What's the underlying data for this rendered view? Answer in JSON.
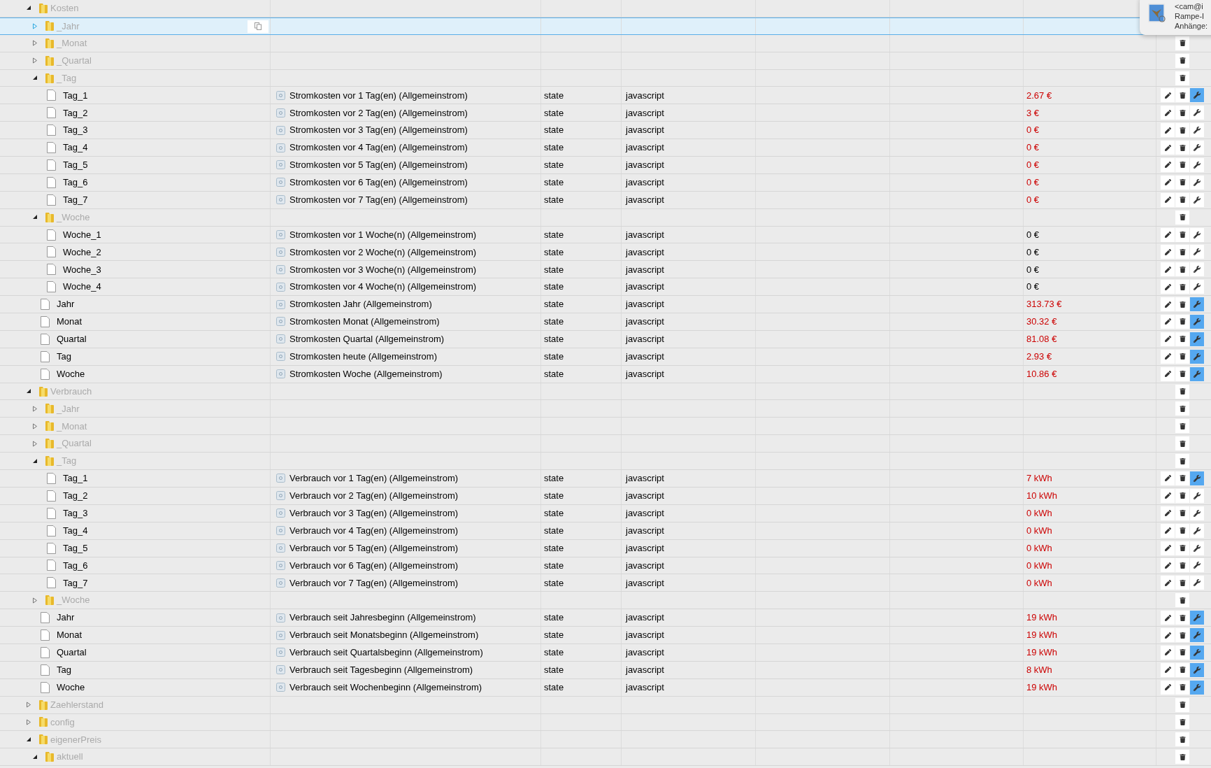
{
  "tree": [
    {
      "kind": "folder",
      "name": "Kosten",
      "expanded": true,
      "selected": false,
      "children": [
        {
          "kind": "folder",
          "name": "_Jahr",
          "expanded": false,
          "selected": true
        },
        {
          "kind": "folder",
          "name": "_Monat",
          "expanded": false,
          "selected": false
        },
        {
          "kind": "folder",
          "name": "_Quartal",
          "expanded": false,
          "selected": false
        },
        {
          "kind": "folder",
          "name": "_Tag",
          "expanded": true,
          "selected": false,
          "children": [
            {
              "kind": "state",
              "name": "Tag_1",
              "description": "Stromkosten vor 1 Tag(en) (Allgemeinstrom)",
              "type": "state",
              "role": "javascript",
              "value": "2.67 €",
              "color": "#cc0000",
              "wrench_active": true,
              "selected": false
            },
            {
              "kind": "state",
              "name": "Tag_2",
              "description": "Stromkosten vor 2 Tag(en) (Allgemeinstrom)",
              "type": "state",
              "role": "javascript",
              "value": "3 €",
              "color": "#cc0000",
              "wrench_active": false,
              "selected": false
            },
            {
              "kind": "state",
              "name": "Tag_3",
              "description": "Stromkosten vor 3 Tag(en) (Allgemeinstrom)",
              "type": "state",
              "role": "javascript",
              "value": "0 €",
              "color": "#cc0000",
              "wrench_active": false,
              "selected": false
            },
            {
              "kind": "state",
              "name": "Tag_4",
              "description": "Stromkosten vor 4 Tag(en) (Allgemeinstrom)",
              "type": "state",
              "role": "javascript",
              "value": "0 €",
              "color": "#cc0000",
              "wrench_active": false,
              "selected": false
            },
            {
              "kind": "state",
              "name": "Tag_5",
              "description": "Stromkosten vor 5 Tag(en) (Allgemeinstrom)",
              "type": "state",
              "role": "javascript",
              "value": "0 €",
              "color": "#cc0000",
              "wrench_active": false,
              "selected": false
            },
            {
              "kind": "state",
              "name": "Tag_6",
              "description": "Stromkosten vor 6 Tag(en) (Allgemeinstrom)",
              "type": "state",
              "role": "javascript",
              "value": "0 €",
              "color": "#cc0000",
              "wrench_active": false,
              "selected": false
            },
            {
              "kind": "state",
              "name": "Tag_7",
              "description": "Stromkosten vor 7 Tag(en) (Allgemeinstrom)",
              "type": "state",
              "role": "javascript",
              "value": "0 €",
              "color": "#cc0000",
              "wrench_active": false,
              "selected": false
            }
          ]
        },
        {
          "kind": "folder",
          "name": "_Woche",
          "expanded": true,
          "selected": false,
          "children": [
            {
              "kind": "state",
              "name": "Woche_1",
              "description": "Stromkosten vor 1 Woche(n) (Allgemeinstrom)",
              "type": "state",
              "role": "javascript",
              "value": "0 €",
              "color": "#000000",
              "wrench_active": false,
              "selected": false
            },
            {
              "kind": "state",
              "name": "Woche_2",
              "description": "Stromkosten vor 2 Woche(n) (Allgemeinstrom)",
              "type": "state",
              "role": "javascript",
              "value": "0 €",
              "color": "#000000",
              "wrench_active": false,
              "selected": false
            },
            {
              "kind": "state",
              "name": "Woche_3",
              "description": "Stromkosten vor 3 Woche(n) (Allgemeinstrom)",
              "type": "state",
              "role": "javascript",
              "value": "0 €",
              "color": "#000000",
              "wrench_active": false,
              "selected": false
            },
            {
              "kind": "state",
              "name": "Woche_4",
              "description": "Stromkosten vor 4 Woche(n) (Allgemeinstrom)",
              "type": "state",
              "role": "javascript",
              "value": "0 €",
              "color": "#000000",
              "wrench_active": false,
              "selected": false
            }
          ]
        },
        {
          "kind": "state",
          "name": "Jahr",
          "description": "Stromkosten Jahr (Allgemeinstrom)",
          "type": "state",
          "role": "javascript",
          "value": "313.73 €",
          "color": "#cc0000",
          "wrench_active": true,
          "selected": false
        },
        {
          "kind": "state",
          "name": "Monat",
          "description": "Stromkosten Monat (Allgemeinstrom)",
          "type": "state",
          "role": "javascript",
          "value": "30.32 €",
          "color": "#cc0000",
          "wrench_active": true,
          "selected": false
        },
        {
          "kind": "state",
          "name": "Quartal",
          "description": "Stromkosten Quartal (Allgemeinstrom)",
          "type": "state",
          "role": "javascript",
          "value": "81.08 €",
          "color": "#cc0000",
          "wrench_active": true,
          "selected": false
        },
        {
          "kind": "state",
          "name": "Tag",
          "description": "Stromkosten heute (Allgemeinstrom)",
          "type": "state",
          "role": "javascript",
          "value": "2.93 €",
          "color": "#cc0000",
          "wrench_active": true,
          "selected": false
        },
        {
          "kind": "state",
          "name": "Woche",
          "description": "Stromkosten Woche (Allgemeinstrom)",
          "type": "state",
          "role": "javascript",
          "value": "10.86 €",
          "color": "#cc0000",
          "wrench_active": true,
          "selected": false
        }
      ]
    },
    {
      "kind": "folder",
      "name": "Verbrauch",
      "expanded": true,
      "selected": false,
      "children": [
        {
          "kind": "folder",
          "name": "_Jahr",
          "expanded": false,
          "selected": false
        },
        {
          "kind": "folder",
          "name": "_Monat",
          "expanded": false,
          "selected": false
        },
        {
          "kind": "folder",
          "name": "_Quartal",
          "expanded": false,
          "selected": false
        },
        {
          "kind": "folder",
          "name": "_Tag",
          "expanded": true,
          "selected": false,
          "children": [
            {
              "kind": "state",
              "name": "Tag_1",
              "description": "Verbrauch vor 1 Tag(en) (Allgemeinstrom)",
              "type": "state",
              "role": "javascript",
              "value": "7 kWh",
              "color": "#cc0000",
              "wrench_active": true,
              "selected": false
            },
            {
              "kind": "state",
              "name": "Tag_2",
              "description": "Verbrauch vor 2 Tag(en) (Allgemeinstrom)",
              "type": "state",
              "role": "javascript",
              "value": "10 kWh",
              "color": "#cc0000",
              "wrench_active": false,
              "selected": false
            },
            {
              "kind": "state",
              "name": "Tag_3",
              "description": "Verbrauch vor 3 Tag(en) (Allgemeinstrom)",
              "type": "state",
              "role": "javascript",
              "value": "0 kWh",
              "color": "#cc0000",
              "wrench_active": false,
              "selected": false
            },
            {
              "kind": "state",
              "name": "Tag_4",
              "description": "Verbrauch vor 4 Tag(en) (Allgemeinstrom)",
              "type": "state",
              "role": "javascript",
              "value": "0 kWh",
              "color": "#cc0000",
              "wrench_active": false,
              "selected": false
            },
            {
              "kind": "state",
              "name": "Tag_5",
              "description": "Verbrauch vor 5 Tag(en) (Allgemeinstrom)",
              "type": "state",
              "role": "javascript",
              "value": "0 kWh",
              "color": "#cc0000",
              "wrench_active": false,
              "selected": false
            },
            {
              "kind": "state",
              "name": "Tag_6",
              "description": "Verbrauch vor 6 Tag(en) (Allgemeinstrom)",
              "type": "state",
              "role": "javascript",
              "value": "0 kWh",
              "color": "#cc0000",
              "wrench_active": false,
              "selected": false
            },
            {
              "kind": "state",
              "name": "Tag_7",
              "description": "Verbrauch vor 7 Tag(en) (Allgemeinstrom)",
              "type": "state",
              "role": "javascript",
              "value": "0 kWh",
              "color": "#cc0000",
              "wrench_active": false,
              "selected": false
            }
          ]
        },
        {
          "kind": "folder",
          "name": "_Woche",
          "expanded": false,
          "selected": false
        },
        {
          "kind": "state",
          "name": "Jahr",
          "description": "Verbrauch seit Jahresbeginn (Allgemeinstrom)",
          "type": "state",
          "role": "javascript",
          "value": "19 kWh",
          "color": "#cc0000",
          "wrench_active": true,
          "selected": false
        },
        {
          "kind": "state",
          "name": "Monat",
          "description": "Verbrauch seit Monatsbeginn (Allgemeinstrom)",
          "type": "state",
          "role": "javascript",
          "value": "19 kWh",
          "color": "#cc0000",
          "wrench_active": true,
          "selected": false
        },
        {
          "kind": "state",
          "name": "Quartal",
          "description": "Verbrauch seit Quartalsbeginn (Allgemeinstrom)",
          "type": "state",
          "role": "javascript",
          "value": "19 kWh",
          "color": "#cc0000",
          "wrench_active": true,
          "selected": false
        },
        {
          "kind": "state",
          "name": "Tag",
          "description": "Verbrauch seit Tagesbeginn (Allgemeinstrom)",
          "type": "state",
          "role": "javascript",
          "value": "8 kWh",
          "color": "#cc0000",
          "wrench_active": true,
          "selected": false
        },
        {
          "kind": "state",
          "name": "Woche",
          "description": "Verbrauch seit Wochenbeginn (Allgemeinstrom)",
          "type": "state",
          "role": "javascript",
          "value": "19 kWh",
          "color": "#cc0000",
          "wrench_active": true,
          "selected": false
        }
      ]
    },
    {
      "kind": "folder",
      "name": "Zaehlerstand",
      "expanded": false,
      "selected": false
    },
    {
      "kind": "folder",
      "name": "config",
      "expanded": false,
      "selected": false
    },
    {
      "kind": "folder",
      "name": "eigenerPreis",
      "expanded": true,
      "selected": false,
      "children": [
        {
          "kind": "folder",
          "name": "aktuell",
          "expanded": true,
          "selected": false
        }
      ]
    }
  ],
  "notification": {
    "lines": [
      "<cam@i",
      "Rampe-I",
      "Anhänge:"
    ]
  }
}
